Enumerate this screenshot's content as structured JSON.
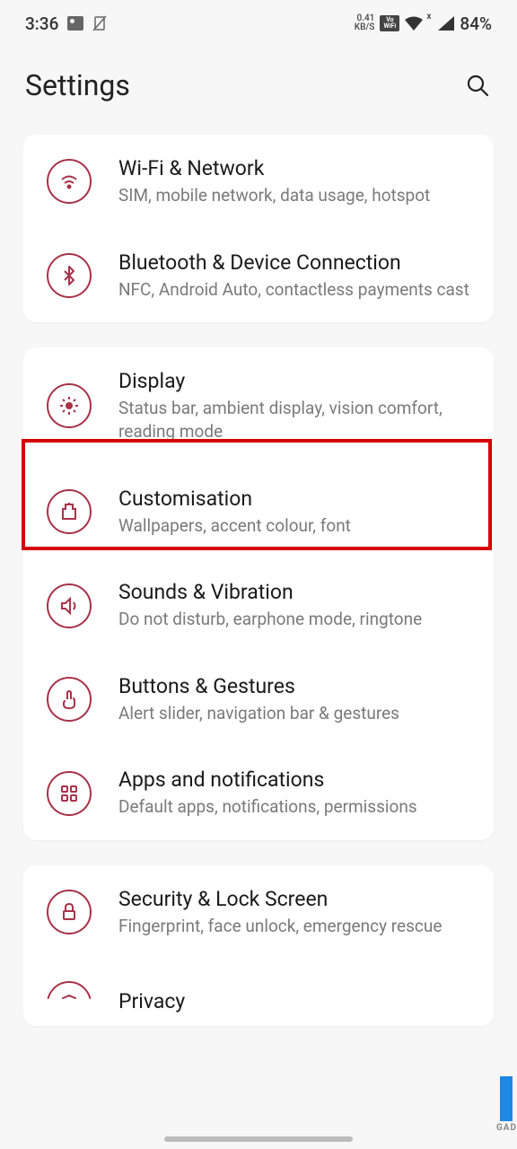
{
  "status": {
    "time": "3:36",
    "data_rate": "0.41",
    "data_unit": "KB/S",
    "battery": "84%",
    "vowifi_top": "Vo",
    "vowifi_bot": "WiFi",
    "signal_x": "x"
  },
  "header": {
    "title": "Settings"
  },
  "groups": [
    {
      "items": [
        {
          "icon": "wifi",
          "title": "Wi-Fi & Network",
          "subtitle": "SIM, mobile network, data usage, hotspot"
        },
        {
          "icon": "bluetooth",
          "title": "Bluetooth & Device Connection",
          "subtitle": "NFC, Android Auto, contactless payments cast"
        }
      ]
    },
    {
      "items": [
        {
          "icon": "display",
          "title": "Display",
          "subtitle": "Status bar, ambient display, vision comfort, reading mode",
          "highlighted": true
        },
        {
          "icon": "customisation",
          "title": "Customisation",
          "subtitle": "Wallpapers, accent colour, font"
        },
        {
          "icon": "sound",
          "title": "Sounds & Vibration",
          "subtitle": "Do not disturb, earphone mode, ringtone"
        },
        {
          "icon": "gestures",
          "title": "Buttons & Gestures",
          "subtitle": "Alert slider, navigation bar & gestures"
        },
        {
          "icon": "apps",
          "title": "Apps and notifications",
          "subtitle": "Default apps, notifications, permissions"
        }
      ]
    },
    {
      "items": [
        {
          "icon": "security",
          "title": "Security & Lock Screen",
          "subtitle": "Fingerprint, face unlock, emergency rescue"
        },
        {
          "icon": "privacy",
          "title": "Privacy",
          "subtitle": ""
        }
      ]
    }
  ],
  "watermark": "GAD"
}
